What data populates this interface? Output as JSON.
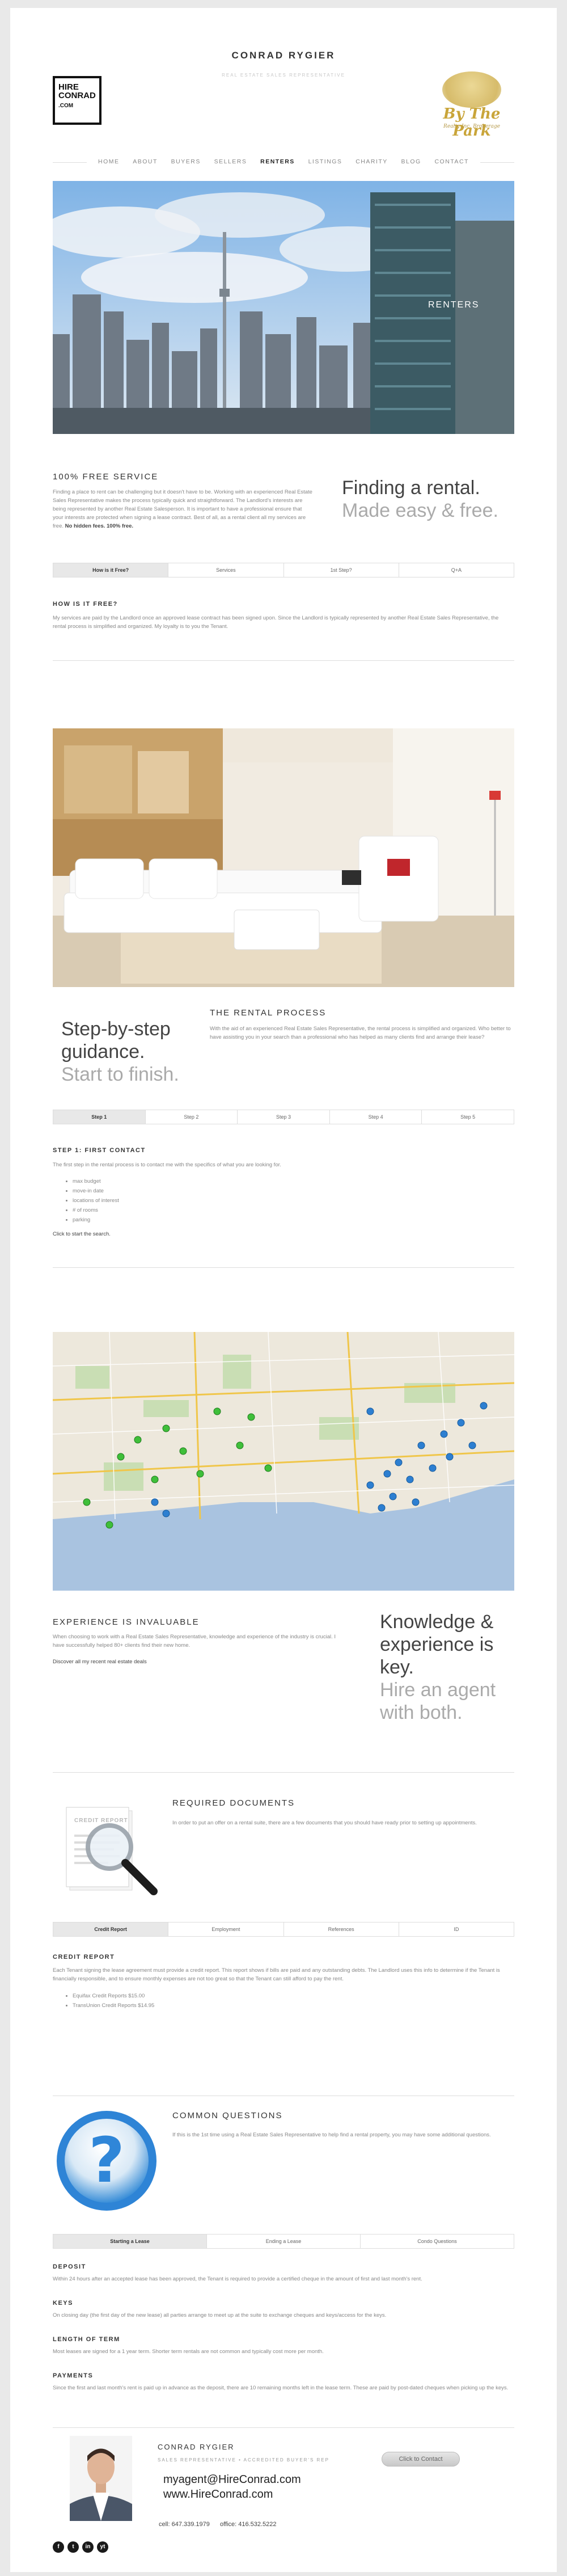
{
  "header": {
    "site_name": "CONRAD RYGIER",
    "tagline": "REAL ESTATE SALES REPRESENTATIVE",
    "logo_left": {
      "line1": "HIRE",
      "line2": "CONRAD",
      "line3": ".COM"
    },
    "logo_right": {
      "name": "By The Park",
      "sub": "Realty Inc. Brokerage"
    }
  },
  "nav": {
    "items": [
      "HOME",
      "ABOUT",
      "BUYERS",
      "SELLERS",
      "RENTERS",
      "LISTINGS",
      "CHARITY",
      "BLOG",
      "CONTACT"
    ],
    "active": "RENTERS"
  },
  "hero": {
    "caption": "RENTERS"
  },
  "free_service": {
    "title": "100% FREE SERVICE",
    "body": "Finding a place to rent can be challenging but it doesn't have to be. Working with an experienced Real Estate Sales Representative makes the process typically quick and straightforward. The Landlord's interests are being represented by another Real Estate Salesperson. It is important to have a professional ensure that your interests are protected when signing a lease contract. Best of all, as a rental client all my services are free.",
    "body_bold": "No hidden fees. 100% free.",
    "tagline_dark": "Finding a rental.",
    "tagline_light": "Made easy & free.",
    "tabs": [
      "How is it Free?",
      "Services",
      "1st Step?",
      "Q+A"
    ],
    "active_tab": 0,
    "sub_title": "HOW IS IT FREE?",
    "sub_body": "My services are paid by the Landlord once an approved lease contract has been signed upon. Since the Landlord is typically represented by another Real Estate Sales Representative, the rental process is simplified and organized. My loyalty is to you the Tenant."
  },
  "rental_process": {
    "tagline_dark": "Step-by-step guidance.",
    "tagline_light": "Start to finish.",
    "title": "THE RENTAL PROCESS",
    "body": "With the aid of an experienced Real Estate Sales Representative, the rental process is simplified and organized. Who better to have assisting you in your search than a professional who has helped as many clients find and arrange their lease?",
    "tabs": [
      "Step 1",
      "Step 2",
      "Step 3",
      "Step 4",
      "Step 5"
    ],
    "active_tab": 0,
    "sub_title": "STEP 1: FIRST CONTACT",
    "sub_body": "The first step in the rental process is to contact me with the specifics of what you are looking for.",
    "bullets": [
      "max budget",
      "move-in date",
      "locations of interest",
      "# of rooms",
      "parking"
    ],
    "link": "Click to start the search."
  },
  "experience": {
    "title": "EXPERIENCE IS INVALUABLE",
    "body": "When choosing to work with a Real Estate Sales Representative, knowledge and experience of the industry is crucial. I have successfully helped 80+ clients find their new home.",
    "link": "Discover all my recent real estate deals",
    "tagline_dark": "Knowledge & experience is key.",
    "tagline_light": "Hire an agent with both."
  },
  "documents": {
    "title": "REQUIRED DOCUMENTS",
    "body": "In order to put an offer on a rental suite, there are a few documents that you should have ready prior to setting up appointments.",
    "icon_label": "CREDIT REPORT",
    "tabs": [
      "Credit Report",
      "Employment",
      "References",
      "ID"
    ],
    "active_tab": 0,
    "sub_title": "CREDIT REPORT",
    "sub_body": "Each Tenant signing the lease agreement must provide a credit report. This report shows if bills are paid and any outstanding debts. The Landlord uses this info to determine if the Tenant is financially responsible, and to ensure monthly expenses are not too great so that the Tenant can still afford to pay the rent.",
    "bullets": [
      "Equifax Credit Reports $15.00",
      "TransUnion Credit Reports $14.95"
    ]
  },
  "questions": {
    "title": "COMMON QUESTIONS",
    "body": "If this is the 1st time using a Real Estate Sales Representative to help find a rental property, you may have some additional questions.",
    "tabs": [
      "Starting a Lease",
      "Ending a Lease",
      "Condo Questions"
    ],
    "active_tab": 0,
    "items": [
      {
        "title": "DEPOSIT",
        "body": "Within 24 hours after an accepted lease has been approved, the Tenant is required to provide a certified cheque in the amount of first and last month's rent."
      },
      {
        "title": "KEYS",
        "body": "On closing day (the first day of the new lease) all parties arrange to meet up at the suite to exchange cheques and keys/access for the keys."
      },
      {
        "title": "LENGTH OF TERM",
        "body": "Most leases are signed for a 1 year term. Shorter term rentals are not common and typically cost more per month."
      },
      {
        "title": "PAYMENTS",
        "body": "Since the first and last month's rent is paid up in advance as the deposit, there are 10 remaining months left in the lease term. These are paid by post-dated cheques when picking up the keys."
      }
    ]
  },
  "footer": {
    "name": "CONRAD RYGIER",
    "role": "SALES REPRESENTATIVE • ACCREDITED BUYER'S REP",
    "email": "myagent@HireConrad.com",
    "website": "www.HireConrad.com",
    "contact_button": "Click to Contact",
    "cell": "cell: 647.339.1979",
    "office": "office: 416.532.5222",
    "social": [
      "f",
      "t",
      "in",
      "yt"
    ]
  },
  "colors": {
    "accent": "#333333",
    "muted": "#888888",
    "tab_active": "#e8e8e8"
  }
}
